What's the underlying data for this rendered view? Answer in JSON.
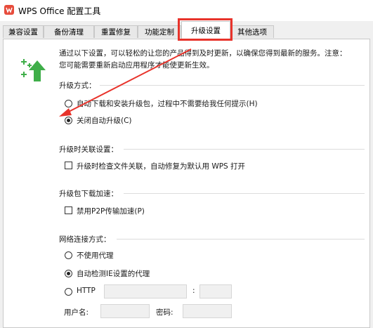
{
  "window": {
    "title": "WPS Office 配置工具",
    "icon": "wps-logo-icon"
  },
  "tabs": [
    {
      "label": "兼容设置",
      "active": false
    },
    {
      "label": "备份清理",
      "active": false
    },
    {
      "label": "重置修复",
      "active": false
    },
    {
      "label": "功能定制",
      "active": false
    },
    {
      "label": "升级设置",
      "active": true
    },
    {
      "label": "其他选项",
      "active": false
    }
  ],
  "description": {
    "line1": "通过以下设置，可以轻松的让您的产品得到及时更新，以确保您得到最新的服务。注意：",
    "line2": "您可能需要重新启动应用程序才能使更新生效。"
  },
  "upgrade_mode": {
    "label": "升级方式：",
    "options": [
      {
        "label": "自动下载和安装升级包，过程中不需要给我任何提示(H)",
        "checked": false
      },
      {
        "label": "关闭自动升级(C)",
        "checked": true
      }
    ]
  },
  "upgrade_assoc": {
    "label": "升级时关联设置：",
    "checkbox_label": "升级时检查文件关联，自动修复为默认用 WPS 打开",
    "checked": false
  },
  "download_accel": {
    "label": "升级包下载加速：",
    "checkbox_label": "禁用P2P传输加速(P)",
    "checked": false
  },
  "network": {
    "label": "网络连接方式：",
    "options": [
      {
        "label": "不使用代理",
        "checked": false
      },
      {
        "label": "自动检测IE设置的代理",
        "checked": true
      },
      {
        "label": "HTTP",
        "checked": false
      }
    ],
    "port_separator": ":",
    "username_label": "用户名:",
    "password_label": "密码:"
  },
  "colors": {
    "highlight_red": "#e8332b",
    "icon_green": "#3fae49"
  }
}
